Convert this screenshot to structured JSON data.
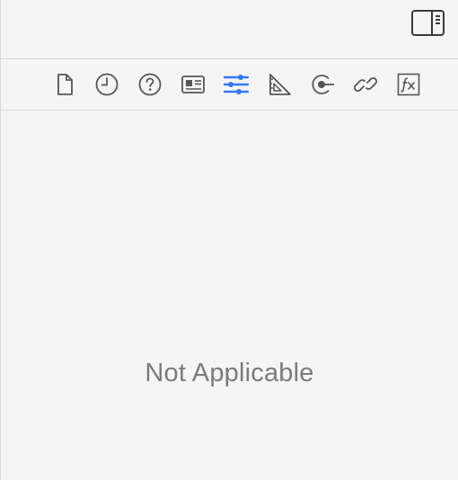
{
  "colors": {
    "background": "#f5f5f5",
    "divider": "#d6d6d6",
    "icon": "#555555",
    "accent": "#3478f6",
    "empty_text": "#7b7b7b"
  },
  "header": {
    "toggle_icon": "sidebar-right-icon"
  },
  "inspector_tabs": [
    {
      "icon": "file-icon",
      "selected": false
    },
    {
      "icon": "clock-icon",
      "selected": false
    },
    {
      "icon": "help-icon",
      "selected": false
    },
    {
      "icon": "identity-card-icon",
      "selected": false
    },
    {
      "icon": "sliders-icon",
      "selected": true
    },
    {
      "icon": "ruler-triangle-icon",
      "selected": false
    },
    {
      "icon": "connection-target-icon",
      "selected": false
    },
    {
      "icon": "link-icon",
      "selected": false
    },
    {
      "icon": "function-fx-icon",
      "selected": false
    }
  ],
  "main": {
    "empty_message": "Not Applicable"
  }
}
